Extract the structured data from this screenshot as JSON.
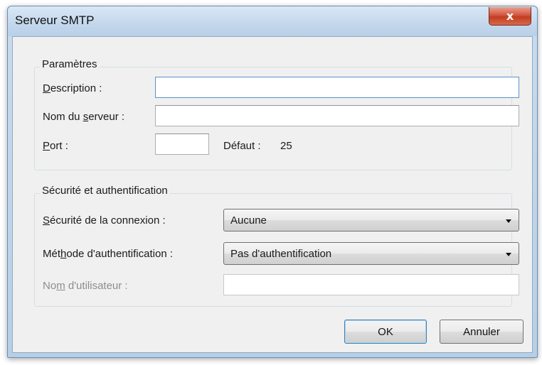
{
  "window": {
    "title": "Serveur SMTP",
    "close_glyph": "x"
  },
  "parametres": {
    "group_label": "Paramètres",
    "description": {
      "label_accel": "D",
      "label_rest": "escription :",
      "value": ""
    },
    "server_name": {
      "label_before": "Nom du ",
      "label_accel": "s",
      "label_after": "erveur :",
      "value": ""
    },
    "port": {
      "label_accel": "P",
      "label_rest": "ort :",
      "value": ""
    },
    "default_label": "Défaut :",
    "default_value": "25"
  },
  "securite": {
    "group_label": "Sécurité et authentification",
    "connection_security": {
      "label_accel": "S",
      "label_rest": "écurité de la connexion :",
      "selected": "Aucune"
    },
    "auth_method": {
      "label_before": "Mét",
      "label_accel": "h",
      "label_after": "ode d'authentification :",
      "selected": "Pas d'authentification"
    },
    "username": {
      "label_before": "No",
      "label_accel": "m",
      "label_after": " d'utilisateur :",
      "value": "",
      "disabled": true
    }
  },
  "buttons": {
    "ok": "OK",
    "cancel": "Annuler"
  }
}
